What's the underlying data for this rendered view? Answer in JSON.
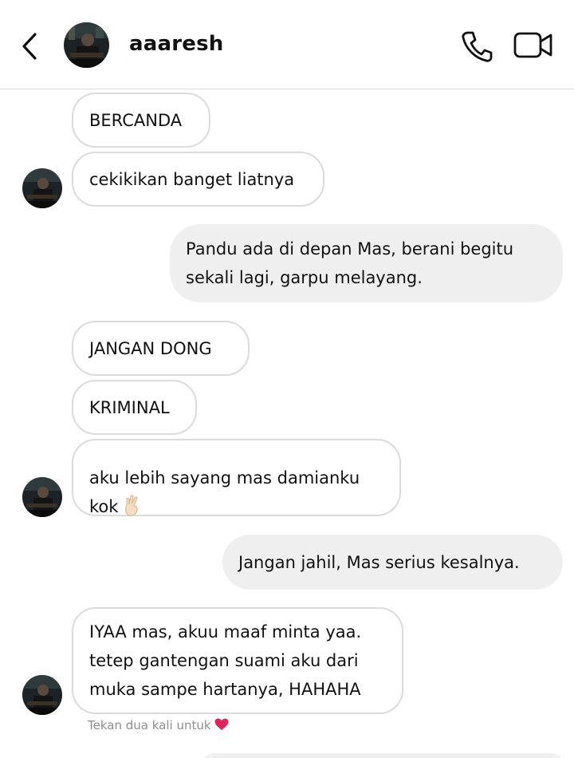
{
  "header": {
    "username": "aaaresh",
    "back_icon": "chevron-left-icon",
    "call_icon": "phone-icon",
    "video_icon": "video-camera-icon"
  },
  "messages": [
    {
      "sender": "them",
      "text": "BERCANDA"
    },
    {
      "sender": "them",
      "text": "cekikikan banget liatnya"
    },
    {
      "sender": "me",
      "text": "Pandu ada di depan Mas, berani begitu\nsekali lagi, garpu melayang."
    },
    {
      "sender": "them",
      "text": "JANGAN DONG"
    },
    {
      "sender": "them",
      "text": "KRIMINAL"
    },
    {
      "sender": "them",
      "text": "aku lebih sayang mas damianku\nkok",
      "emoji": "crossed-fingers-emoji"
    },
    {
      "sender": "me",
      "text": "Jangan jahil, Mas serius kesalnya."
    },
    {
      "sender": "them",
      "text": "IYAA mas, akuu maaf minta yaa.\ntetep gantengan suami aku dari\nmuka sampe hartanya, HAHAHA"
    }
  ],
  "footer": {
    "hint": "Tekan dua kali untuk",
    "heart_icon": "heart-icon"
  },
  "colors": {
    "incoming_border": "#dbdbdb",
    "outgoing_bg": "#efefef",
    "hint_text": "#8e8e8e",
    "heart": "#e0245e"
  }
}
